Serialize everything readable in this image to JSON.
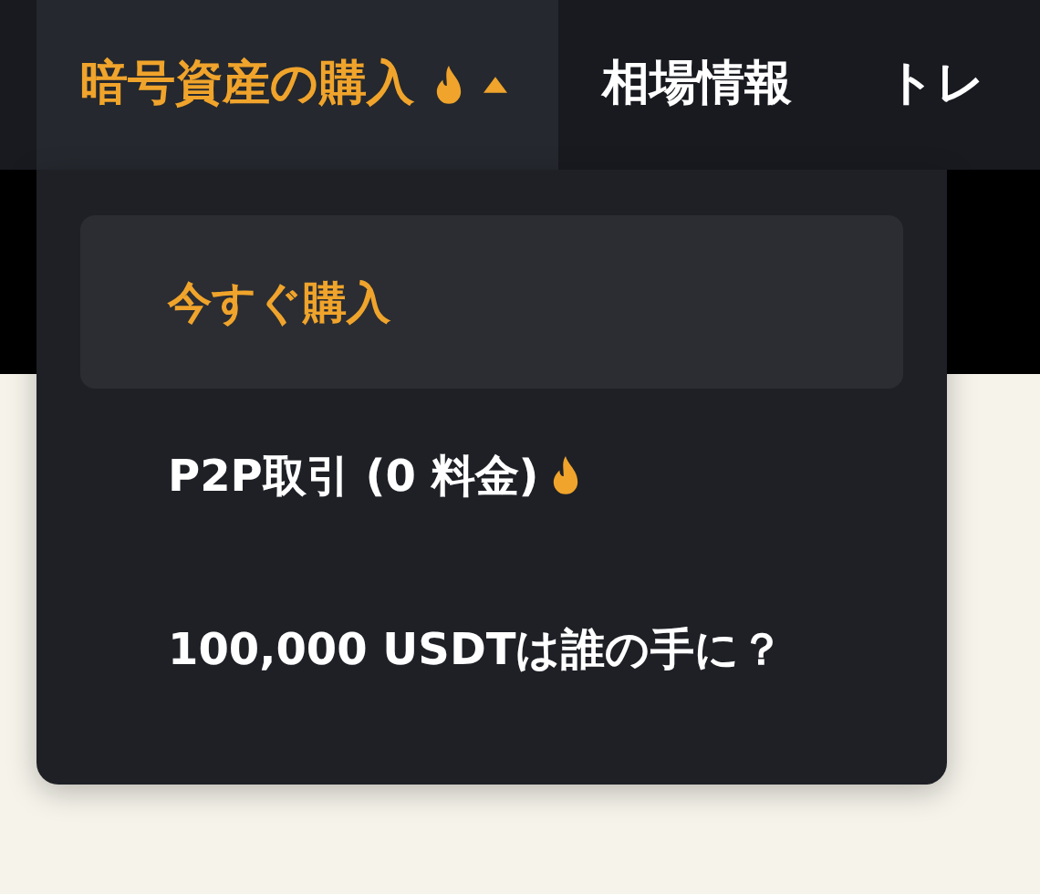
{
  "nav": [
    {
      "label": "暗号資産の購入",
      "selected": true,
      "hot": true,
      "expanded": true
    },
    {
      "label": "相場情報",
      "selected": false,
      "hot": false,
      "expanded": false
    },
    {
      "label": "トレ",
      "selected": false,
      "hot": false,
      "expanded": false
    }
  ],
  "menu": [
    {
      "label": "今すぐ購入",
      "selected": true,
      "hot": false
    },
    {
      "label": "P2P取引 (0 料金)",
      "selected": false,
      "hot": true
    },
    {
      "label": "100,000 USDTは誰の手に？",
      "selected": false,
      "hot": false
    }
  ]
}
